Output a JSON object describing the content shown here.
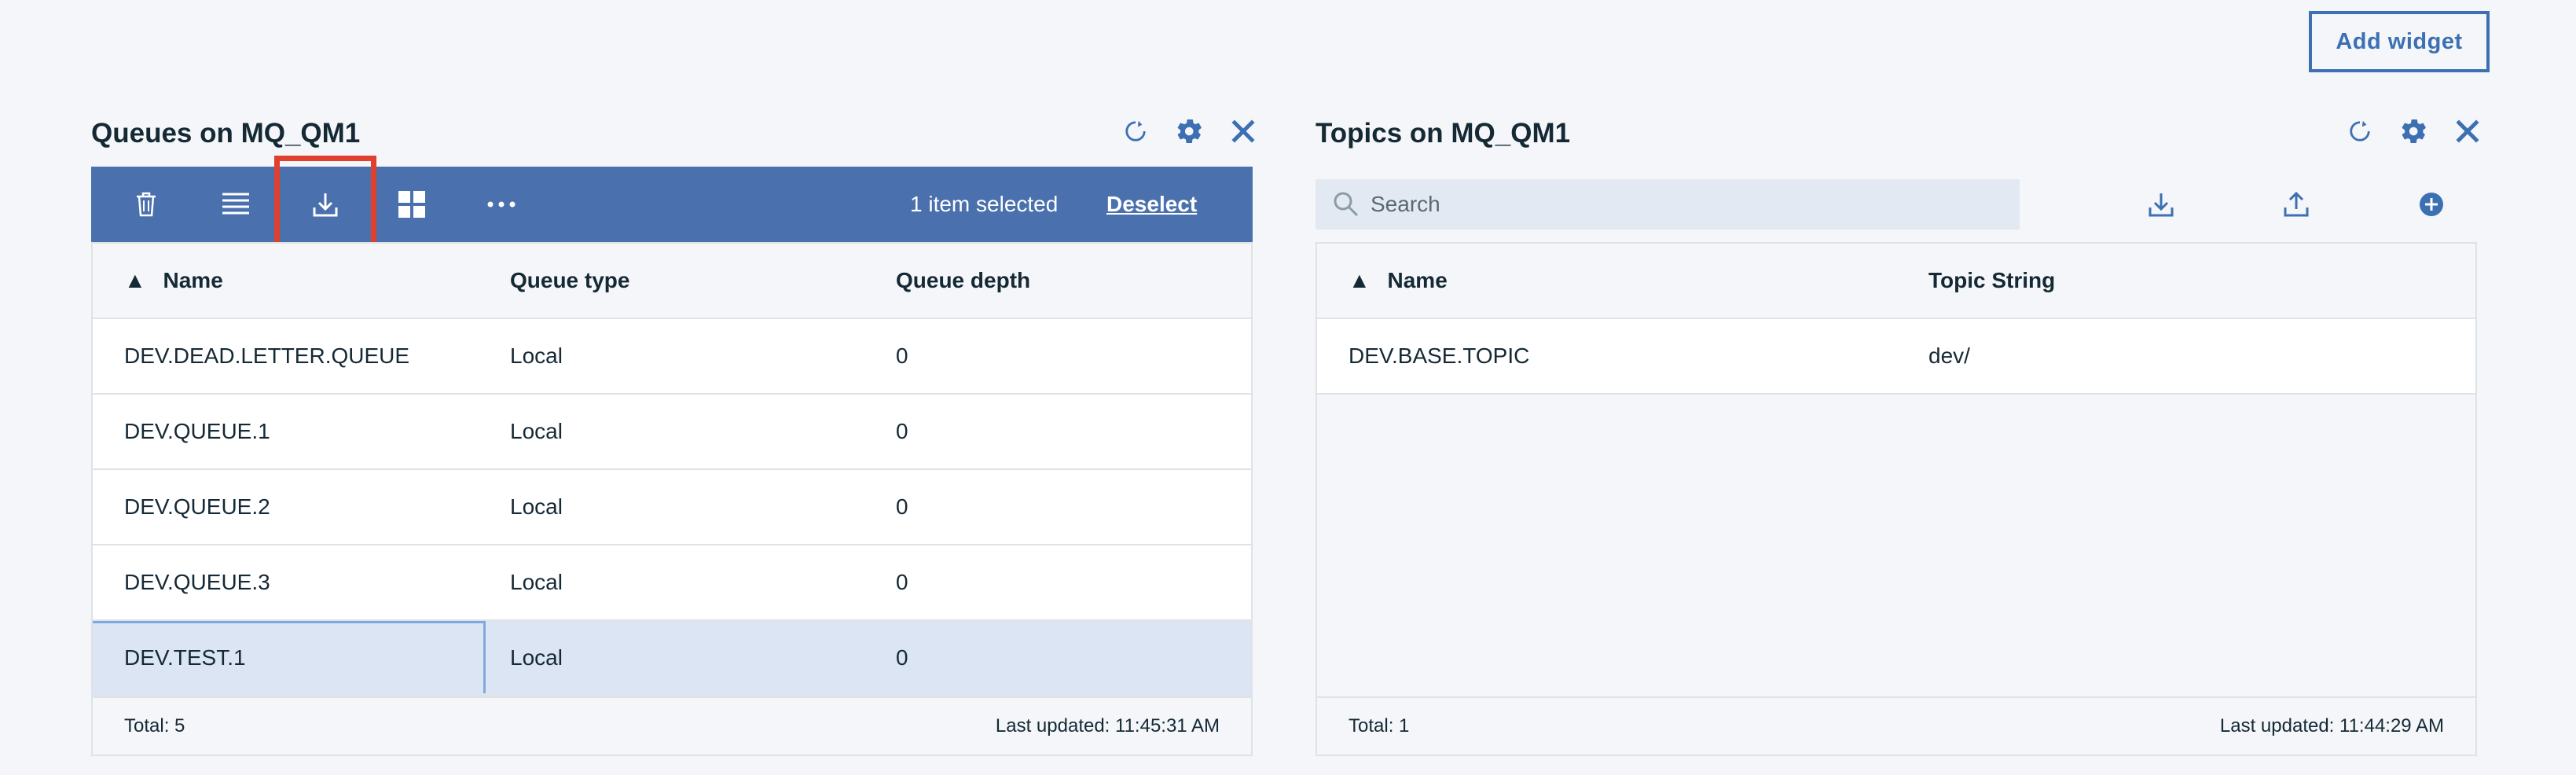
{
  "header": {
    "add_widget_label": "Add widget"
  },
  "queues": {
    "title": "Queues on MQ_QM1",
    "selection_text": "1 item selected",
    "deselect_label": "Deselect",
    "columns": [
      "Name",
      "Queue type",
      "Queue depth"
    ],
    "sort_indicator": "▲",
    "rows": [
      {
        "name": "DEV.DEAD.LETTER.QUEUE",
        "type": "Local",
        "depth": "0"
      },
      {
        "name": "DEV.QUEUE.1",
        "type": "Local",
        "depth": "0"
      },
      {
        "name": "DEV.QUEUE.2",
        "type": "Local",
        "depth": "0"
      },
      {
        "name": "DEV.QUEUE.3",
        "type": "Local",
        "depth": "0"
      },
      {
        "name": "DEV.TEST.1",
        "type": "Local",
        "depth": "0",
        "selected": true
      }
    ],
    "total": "Total: 5",
    "last_updated": "Last updated: 11:45:31 AM",
    "toolbar_icons": [
      "trash-icon",
      "list-icon",
      "download-icon",
      "grid-icon",
      "more-icon"
    ]
  },
  "topics": {
    "title": "Topics on MQ_QM1",
    "search_placeholder": "Search",
    "columns": [
      "Name",
      "Topic String"
    ],
    "sort_indicator": "▲",
    "rows": [
      {
        "name": "DEV.BASE.TOPIC",
        "topic_string": "dev/"
      }
    ],
    "total": "Total: 1",
    "last_updated": "Last updated: 11:44:29 AM",
    "toolbar_icons": [
      "download-icon",
      "upload-icon",
      "add-icon"
    ]
  },
  "colors": {
    "accent": "#3d70b2",
    "toolbar_selected": "#4a71ad",
    "highlight": "#e0402e",
    "selected_row": "#dbe5f4"
  }
}
